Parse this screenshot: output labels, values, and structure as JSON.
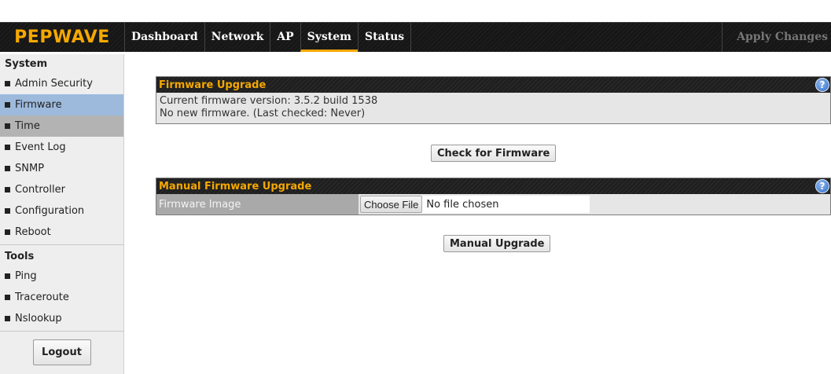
{
  "header": {
    "logo": "PEPWAVE",
    "nav": [
      "Dashboard",
      "Network",
      "AP",
      "System",
      "Status"
    ],
    "active_nav": "System",
    "apply_changes": "Apply Changes"
  },
  "sidebar": {
    "system_heading": "System",
    "system_items": [
      "Admin Security",
      "Firmware",
      "Time",
      "Event Log",
      "SNMP",
      "Controller",
      "Configuration",
      "Reboot"
    ],
    "tools_heading": "Tools",
    "tools_items": [
      "Ping",
      "Traceroute",
      "Nslookup"
    ],
    "logout": "Logout"
  },
  "firmware_upgrade": {
    "title": "Firmware Upgrade",
    "current_version": "Current firmware version: 3.5.2 build 1538",
    "status": "No new firmware. (Last checked: Never)",
    "check_button": "Check for Firmware"
  },
  "manual_upgrade": {
    "title": "Manual Firmware Upgrade",
    "image_label": "Firmware Image",
    "choose_file": "Choose File",
    "file_status": "No file chosen",
    "upgrade_button": "Manual Upgrade"
  },
  "icons": {
    "help": "help-icon",
    "bullet": "square-bullet-icon"
  },
  "colors": {
    "accent": "#f5a800",
    "selected": "#9dbadd",
    "bar": "#161616"
  }
}
